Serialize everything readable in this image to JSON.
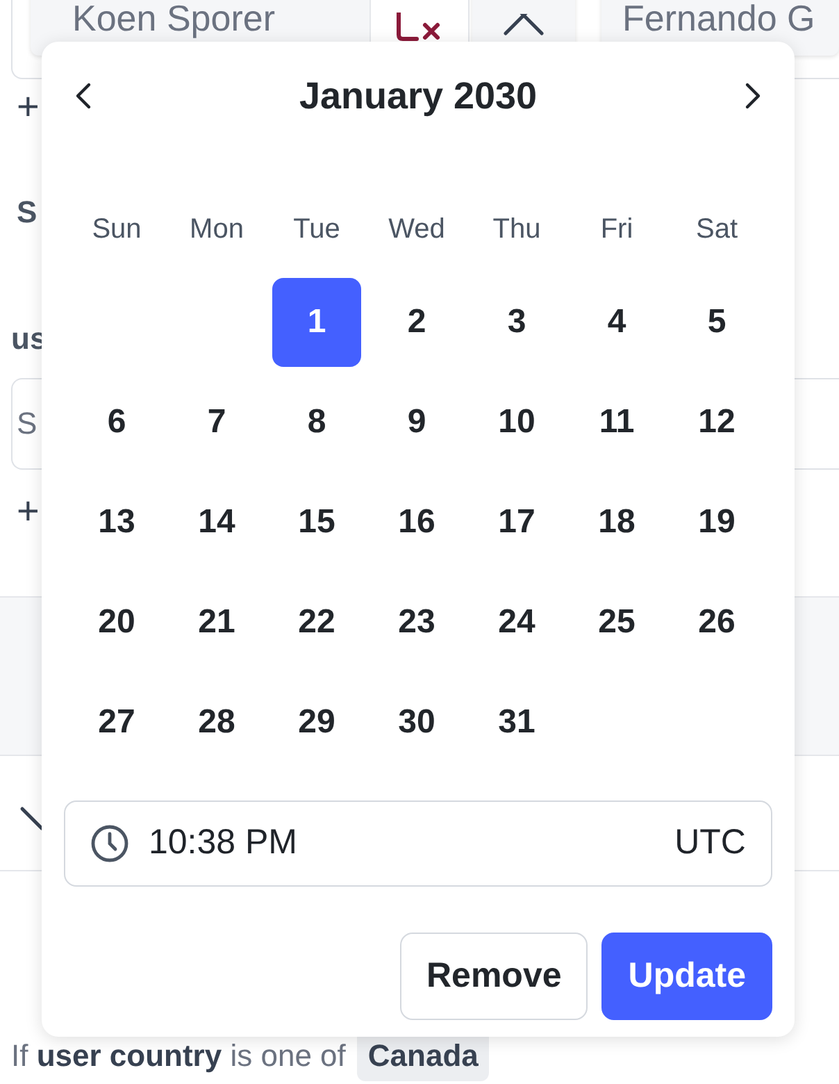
{
  "background": {
    "first_field": "Koen Sporer",
    "second_field": "Fernando G",
    "add_symbol_top": "+",
    "add_symbol_bottom": "+",
    "section_letter": "S",
    "section_label": "us",
    "input_placeholder": "S",
    "rule_text": "If **user country** is one of",
    "rule_value": "Canada"
  },
  "date_picker": {
    "month_title": "January 2030",
    "weekdays": [
      "Sun",
      "Mon",
      "Tue",
      "Wed",
      "Thu",
      "Fri",
      "Sat"
    ],
    "weeks": [
      {
        "kind": "opening",
        "days": [
          {
            "label": "1",
            "selected": true
          },
          {
            "label": "2",
            "selected": false
          },
          {
            "label": "3",
            "selected": false
          },
          {
            "label": "4",
            "selected": false
          },
          {
            "label": "5",
            "selected": false
          }
        ]
      },
      {
        "kind": "regular",
        "days": [
          {
            "label": "6",
            "selected": false
          },
          {
            "label": "7",
            "selected": false
          },
          {
            "label": "8",
            "selected": false
          },
          {
            "label": "9",
            "selected": false
          },
          {
            "label": "10",
            "selected": false
          },
          {
            "label": "11",
            "selected": false
          },
          {
            "label": "12",
            "selected": false
          }
        ]
      },
      {
        "kind": "regular",
        "days": [
          {
            "label": "13",
            "selected": false
          },
          {
            "label": "14",
            "selected": false
          },
          {
            "label": "15",
            "selected": false
          },
          {
            "label": "16",
            "selected": false
          },
          {
            "label": "17",
            "selected": false
          },
          {
            "label": "18",
            "selected": false
          },
          {
            "label": "19",
            "selected": false
          }
        ]
      },
      {
        "kind": "regular",
        "days": [
          {
            "label": "20",
            "selected": false
          },
          {
            "label": "21",
            "selected": false
          },
          {
            "label": "22",
            "selected": false
          },
          {
            "label": "23",
            "selected": false
          },
          {
            "label": "24",
            "selected": false
          },
          {
            "label": "25",
            "selected": false
          },
          {
            "label": "26",
            "selected": false
          }
        ]
      },
      {
        "kind": "regular",
        "days": [
          {
            "label": "27",
            "selected": false
          },
          {
            "label": "28",
            "selected": false
          },
          {
            "label": "29",
            "selected": false
          },
          {
            "label": "30",
            "selected": false
          },
          {
            "label": "31",
            "selected": false
          }
        ]
      }
    ],
    "time": "10:38 PM",
    "timezone": "UTC",
    "buttons": [
      {
        "label": "Remove",
        "kind": "secondary"
      },
      {
        "label": "Update",
        "kind": "primary"
      }
    ]
  }
}
